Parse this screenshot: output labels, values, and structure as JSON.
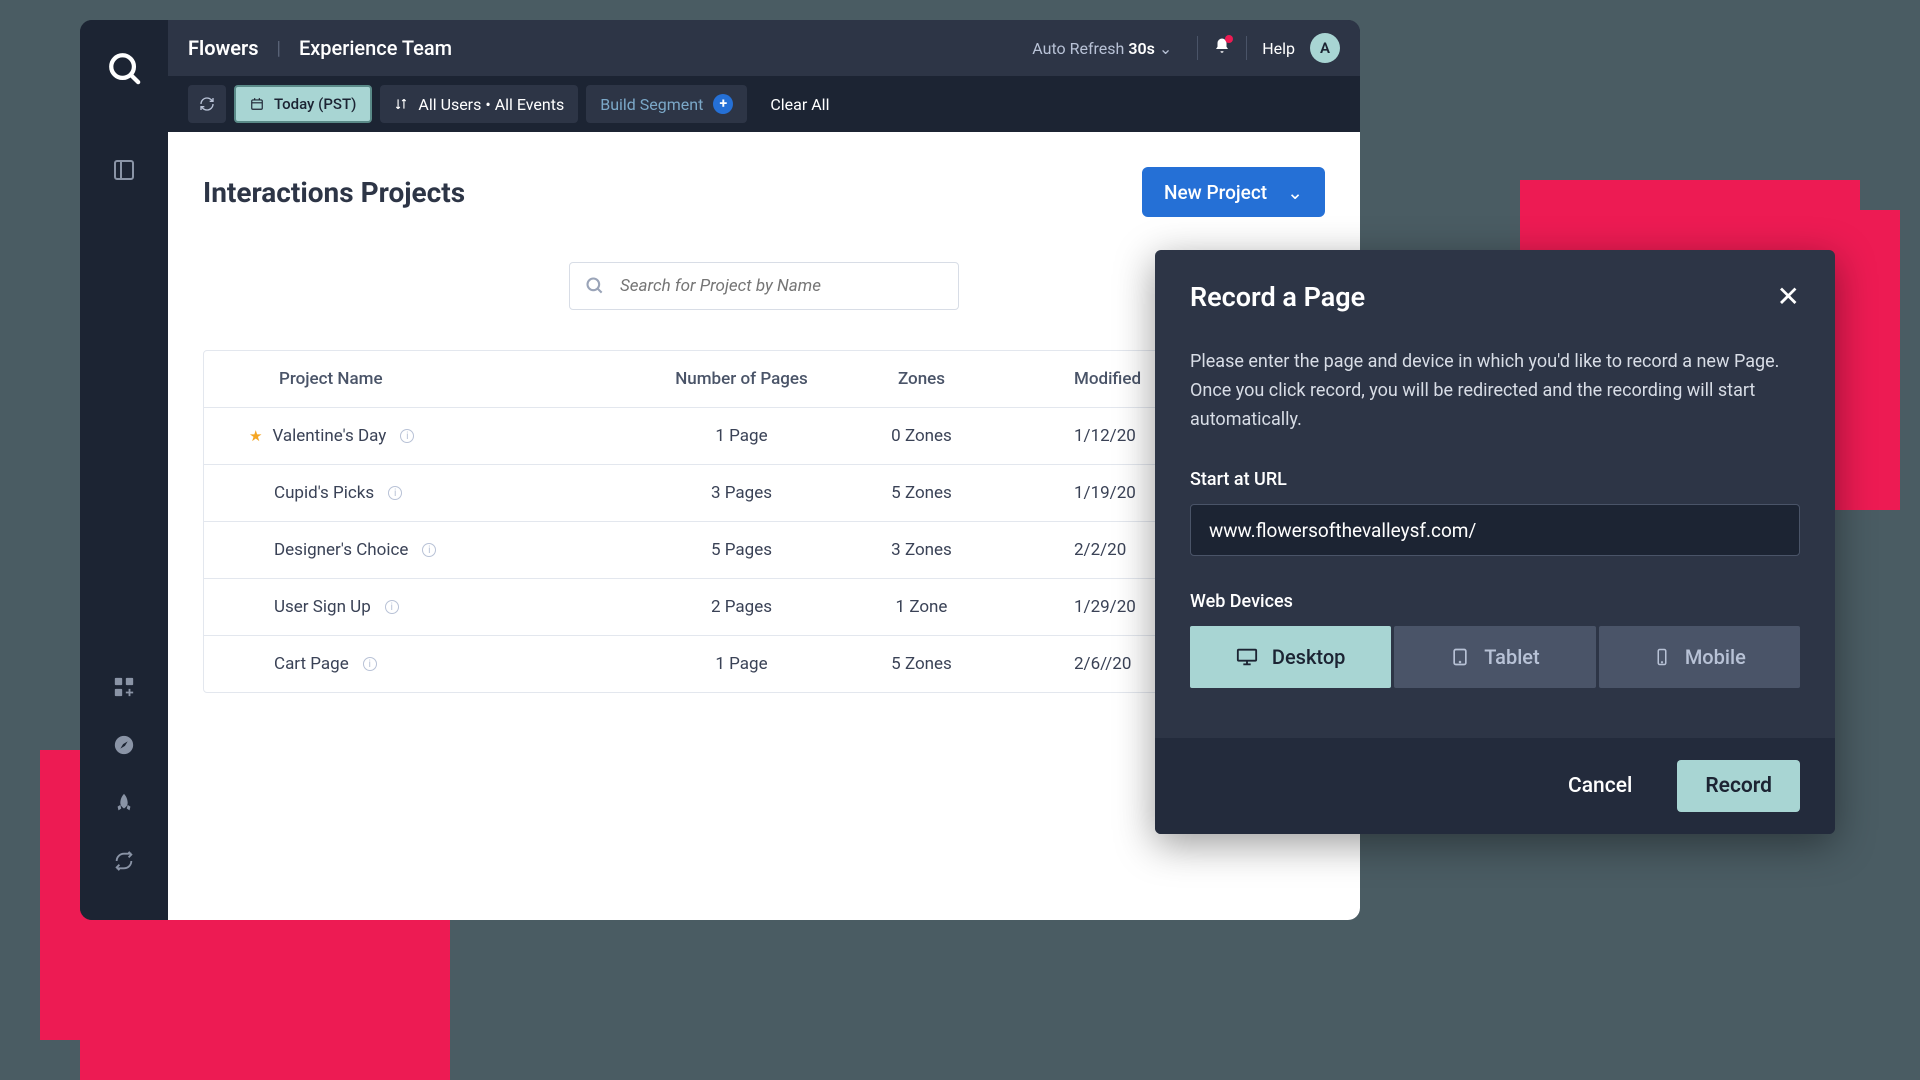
{
  "topbar": {
    "brand": "Flowers",
    "team": "Experience Team",
    "autoRefreshLabel": "Auto Refresh",
    "autoRefreshTime": "30s",
    "help": "Help",
    "avatarLetter": "A"
  },
  "filterbar": {
    "today": "Today (PST)",
    "allUsersEvents": "All Users • All Events",
    "buildSegment": "Build Segment",
    "clearAll": "Clear All"
  },
  "content": {
    "title": "Interactions Projects",
    "newProjectLabel": "New Project",
    "searchPlaceholder": "Search for Project by Name"
  },
  "table": {
    "headers": {
      "name": "Project Name",
      "pages": "Number of Pages",
      "zones": "Zones",
      "modified": "Modified"
    },
    "rows": [
      {
        "starred": true,
        "name": "Valentine's Day",
        "pages": "1 Page",
        "zones": "0 Zones",
        "modified": "1/12/20"
      },
      {
        "starred": false,
        "name": "Cupid's Picks",
        "pages": "3 Pages",
        "zones": "5 Zones",
        "modified": "1/19/20"
      },
      {
        "starred": false,
        "name": "Designer's Choice",
        "pages": "5 Pages",
        "zones": "3 Zones",
        "modified": "2/2/20"
      },
      {
        "starred": false,
        "name": "User Sign Up",
        "pages": "2 Pages",
        "zones": "1 Zone",
        "modified": "1/29/20"
      },
      {
        "starred": false,
        "name": "Cart Page",
        "pages": "1 Page",
        "zones": "5 Zones",
        "modified": "2/6//20"
      }
    ]
  },
  "modal": {
    "title": "Record a Page",
    "description": "Please enter the page and device in which you'd like to record a new Page. Once you click record, you will be redirected and the recording will start automatically.",
    "urlLabel": "Start at URL",
    "urlValue": "www.flowersofthevalleysf.com/",
    "devicesLabel": "Web Devices",
    "devices": {
      "desktop": "Desktop",
      "tablet": "Tablet",
      "mobile": "Mobile"
    },
    "cancelLabel": "Cancel",
    "recordLabel": "Record"
  }
}
